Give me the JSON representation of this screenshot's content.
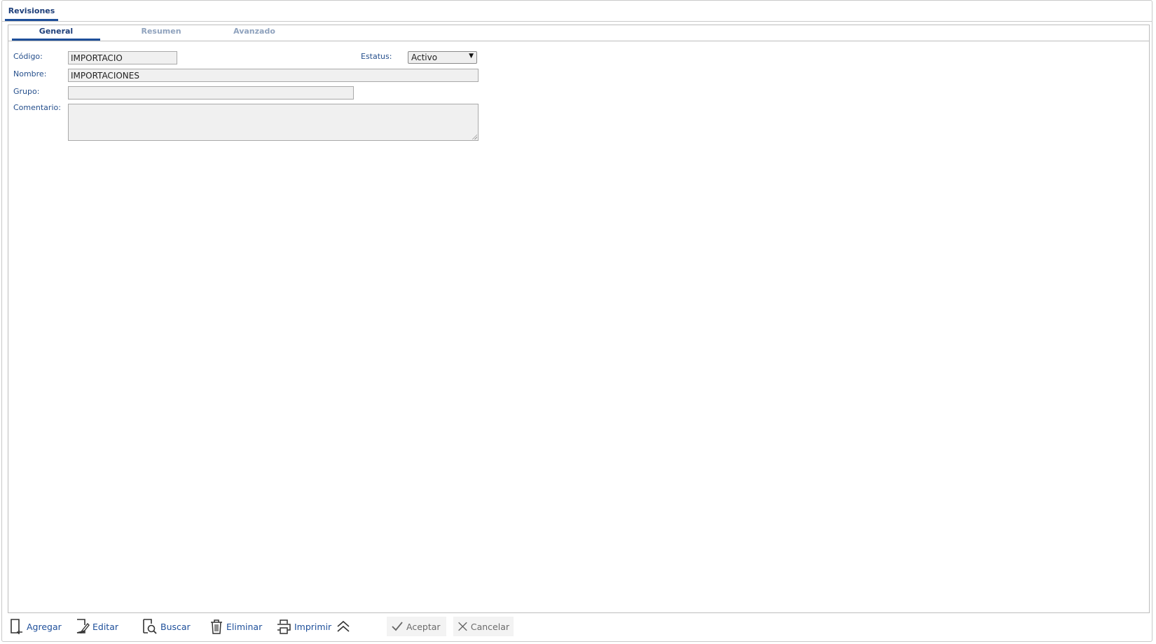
{
  "window": {
    "tab_label": "Revisiones"
  },
  "subtabs": [
    {
      "label": "General"
    },
    {
      "label": "Resumen"
    },
    {
      "label": "Avanzado"
    }
  ],
  "form": {
    "codigo": {
      "label": "Código:",
      "value": "IMPORTACIO"
    },
    "estatus": {
      "label": "Estatus:",
      "value": "Activo"
    },
    "nombre": {
      "label": "Nombre:",
      "value": "IMPORTACIONES"
    },
    "grupo": {
      "label": "Grupo:",
      "value": ""
    },
    "comentario": {
      "label": "Comentario:",
      "value": ""
    }
  },
  "toolbar": {
    "add": "Agregar",
    "edit": "Editar",
    "search": "Buscar",
    "delete": "Eliminar",
    "print": "Imprimir",
    "accept": "Aceptar",
    "cancel": "Cancelar"
  },
  "icons": {
    "add": "add-document-icon",
    "edit": "edit-document-icon",
    "search": "search-document-icon",
    "delete": "trash-icon",
    "print": "printer-icon",
    "collapse": "double-chevron-up-icon",
    "accept": "checkmark-icon",
    "cancel": "close-icon"
  },
  "colors": {
    "accent": "#1e4f9a",
    "label": "#254f8c",
    "inactive_tab": "#8fa2bd",
    "field_bg": "#f0f0f0"
  }
}
